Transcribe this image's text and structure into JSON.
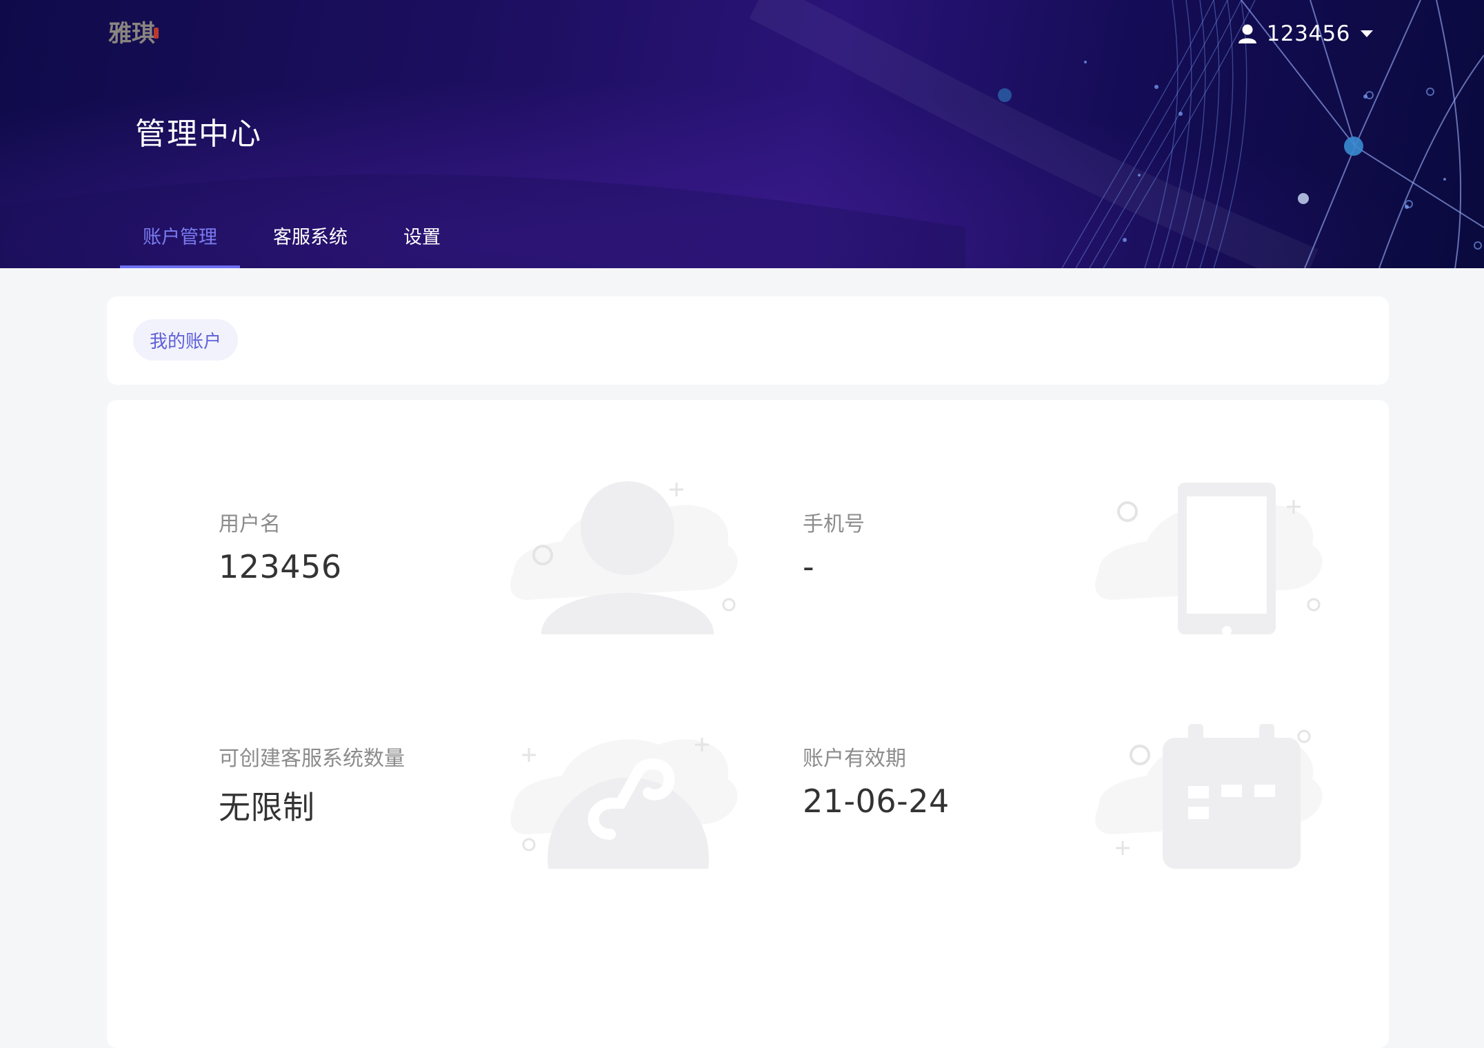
{
  "header": {
    "logo_text": "雅琪",
    "user": {
      "name": "123456",
      "icon": "user-icon",
      "dropdown_icon": "caret-down-icon"
    },
    "title": "管理中心",
    "tabs": [
      {
        "label": "账户管理",
        "active": true
      },
      {
        "label": "客服系统",
        "active": false
      },
      {
        "label": "设置",
        "active": false
      }
    ]
  },
  "subnav": {
    "chip_label": "我的账户"
  },
  "account": {
    "fields": [
      {
        "label": "用户名",
        "value": "123456",
        "icon": "user-illustration"
      },
      {
        "label": "手机号",
        "value": "-",
        "icon": "phone-illustration"
      },
      {
        "label": "可创建客服系统数量",
        "value": "无限制",
        "icon": "mini-program-illustration"
      },
      {
        "label": "账户有效期",
        "value": "21-06-24",
        "icon": "calendar-illustration"
      }
    ]
  },
  "colors": {
    "accent": "#6d6ff2",
    "header_dark": "#0f0b4a",
    "header_purple": "#2a1478",
    "background": "#f5f6f8"
  }
}
